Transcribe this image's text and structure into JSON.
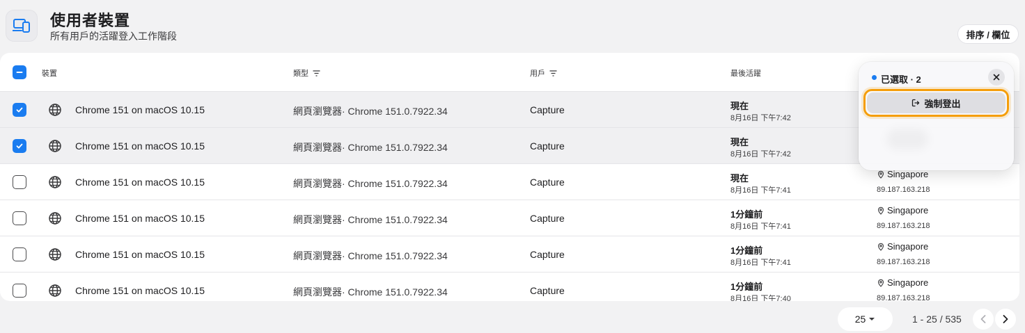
{
  "header": {
    "title": "使用者裝置",
    "subtitle": "所有用戶的活躍登入工作階段",
    "sort_button": "排序 / 欄位"
  },
  "table": {
    "columns": {
      "device": "裝置",
      "type": "類型",
      "user": "用戶",
      "last_activity": "最後活躍"
    },
    "rows": [
      {
        "selected": true,
        "device": "Chrome 151 on macOS 10.15",
        "type": "網頁瀏覽器· Chrome 151.0.7922.34",
        "user": "Capture",
        "activity": "現在",
        "activity_time": "8月16日 下午7:42",
        "location": "",
        "ip": ""
      },
      {
        "selected": true,
        "device": "Chrome 151 on macOS 10.15",
        "type": "網頁瀏覽器· Chrome 151.0.7922.34",
        "user": "Capture",
        "activity": "現在",
        "activity_time": "8月16日 下午7:42",
        "location": "",
        "ip": ""
      },
      {
        "selected": false,
        "device": "Chrome 151 on macOS 10.15",
        "type": "網頁瀏覽器· Chrome 151.0.7922.34",
        "user": "Capture",
        "activity": "現在",
        "activity_time": "8月16日 下午7:41",
        "location": "Singapore",
        "ip": "89.187.163.218"
      },
      {
        "selected": false,
        "device": "Chrome 151 on macOS 10.15",
        "type": "網頁瀏覽器· Chrome 151.0.7922.34",
        "user": "Capture",
        "activity": "1分鐘前",
        "activity_time": "8月16日 下午7:41",
        "location": "Singapore",
        "ip": "89.187.163.218"
      },
      {
        "selected": false,
        "device": "Chrome 151 on macOS 10.15",
        "type": "網頁瀏覽器· Chrome 151.0.7922.34",
        "user": "Capture",
        "activity": "1分鐘前",
        "activity_time": "8月16日 下午7:41",
        "location": "Singapore",
        "ip": "89.187.163.218"
      },
      {
        "selected": false,
        "device": "Chrome 151 on macOS 10.15",
        "type": "網頁瀏覽器· Chrome 151.0.7922.34",
        "user": "Capture",
        "activity": "1分鐘前",
        "activity_time": "8月16日 下午7:40",
        "location": "Singapore",
        "ip": "89.187.163.218"
      }
    ]
  },
  "popover": {
    "selected_label": "已選取 · 2",
    "action_label": "強制登出"
  },
  "pagination": {
    "page_size": "25",
    "range": "1 - 25 / 535"
  },
  "colors": {
    "accent": "#1a7cf0",
    "focus_ring": "#f59e0b"
  }
}
